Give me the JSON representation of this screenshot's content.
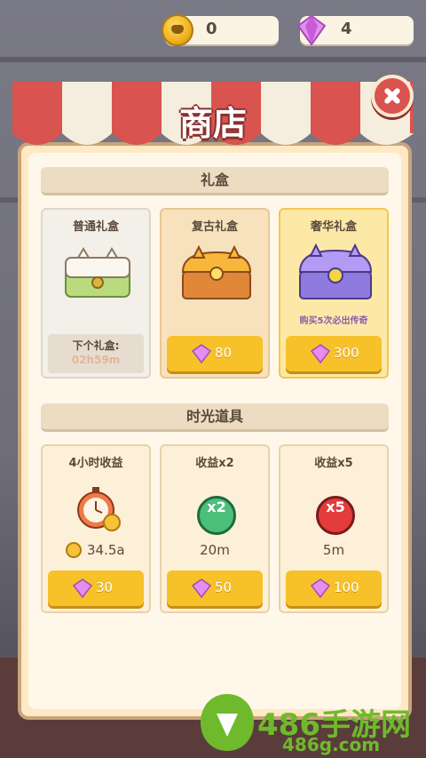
{
  "currency": {
    "coins": "0",
    "gems": "4"
  },
  "shop_title": "商店",
  "sections": {
    "gift_boxes": {
      "title": "礼盒",
      "cards": [
        {
          "title": "普通礼盒",
          "next_label": "下个礼盒:",
          "timer": "02h59m"
        },
        {
          "title": "复古礼盒",
          "price": "80"
        },
        {
          "title": "奢华礼盒",
          "price": "300",
          "note": "购买5次必出传奇"
        }
      ]
    },
    "time_items": {
      "title": "时光道具",
      "cards": [
        {
          "title": "4小时收益",
          "value": "34.5a",
          "price": "30"
        },
        {
          "title": "收益x2",
          "badge": "x2",
          "value": "20m",
          "price": "50"
        },
        {
          "title": "收益x5",
          "badge": "x5",
          "value": "5m",
          "price": "100"
        }
      ]
    }
  },
  "watermark": {
    "brand": "486手游网",
    "site": "486g.com"
  },
  "colors": {
    "awning_red": "#d9534f",
    "button_yellow": "#f7c12a",
    "panel": "#fff7ea",
    "gem": "#d46ee0"
  }
}
